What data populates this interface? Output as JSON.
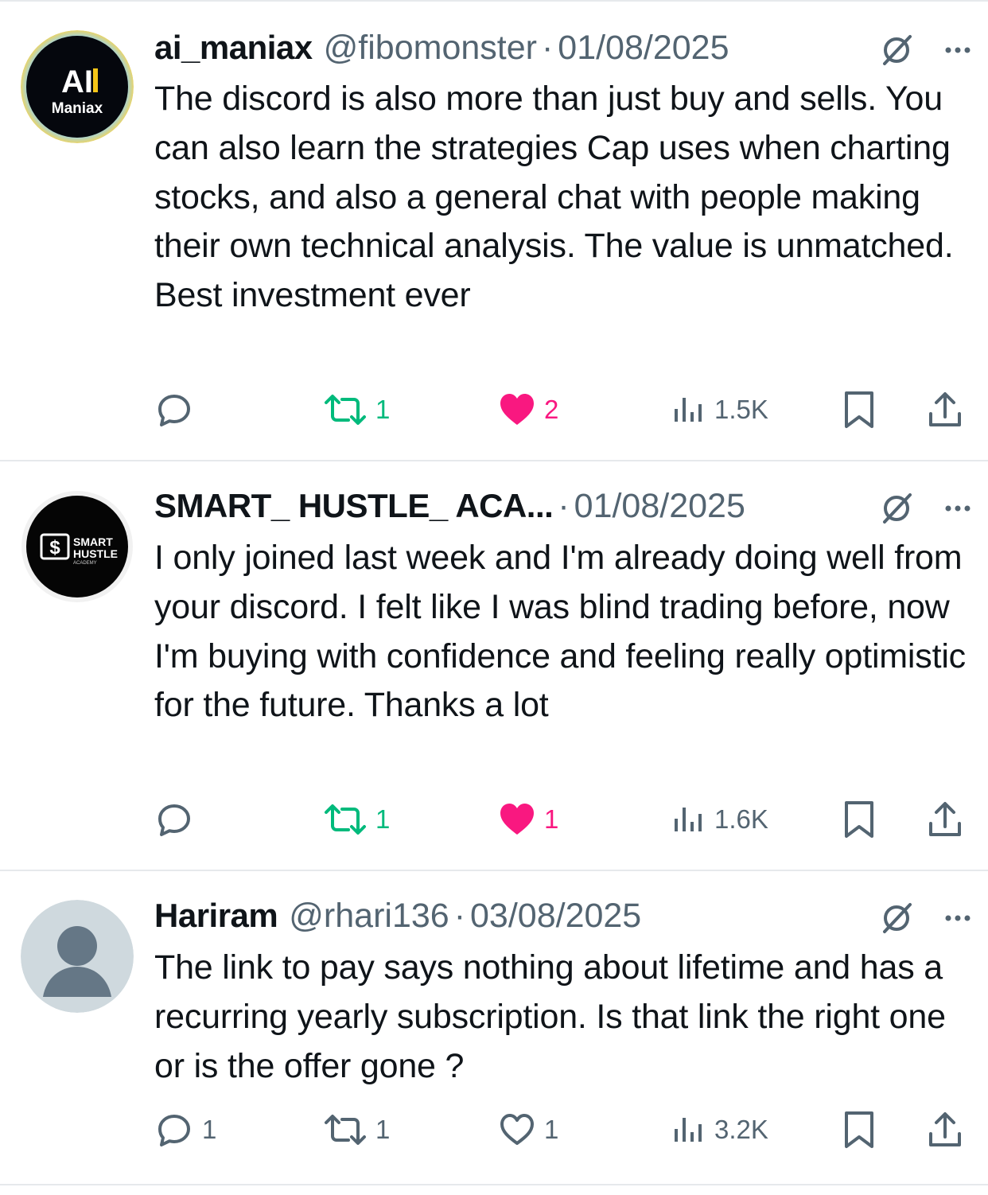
{
  "colors": {
    "retweet": "#00ba7c",
    "like": "#f91880",
    "muted": "#536471",
    "text": "#0f1419",
    "divider": "#e6e9ec"
  },
  "tweets": [
    {
      "name": "ai_maniax",
      "handle": "@fibomonster",
      "separator": "·",
      "date": "01/08/2025",
      "avatar_text_1": "AI",
      "avatar_text_2": "Maniax",
      "text": "The discord is also more than just buy and sells. You can also learn the strategies Cap uses when charting stocks, and also a general chat with people making their own technical analysis. The value is unmatched. Best investment ever",
      "replies": "",
      "retweets": "1",
      "likes": "2",
      "liked": true,
      "views": "1.5K"
    },
    {
      "name": "SMART_ HUSTLE_ ACA...",
      "handle": "",
      "separator": "·",
      "date": "01/08/2025",
      "avatar_text_1": "SMART",
      "avatar_text_2": "HUSTLE",
      "avatar_text_3": "ACADEMY",
      "text": "I only joined last week and I'm already doing well from your discord. I felt like I was blind trading before, now I'm buying with confidence and feeling really optimistic for the future. Thanks a lot",
      "replies": "",
      "retweets": "1",
      "likes": "1",
      "liked": true,
      "views": "1.6K"
    },
    {
      "name": "Hariram",
      "handle": "@rhari136",
      "separator": "·",
      "date": "03/08/2025",
      "text": "The link to pay says nothing about lifetime and has a recurring yearly subscription. Is that link the right one or is the offer gone ?",
      "replies": "1",
      "retweets": "1",
      "likes": "1",
      "liked": false,
      "views": "3.2K"
    }
  ]
}
